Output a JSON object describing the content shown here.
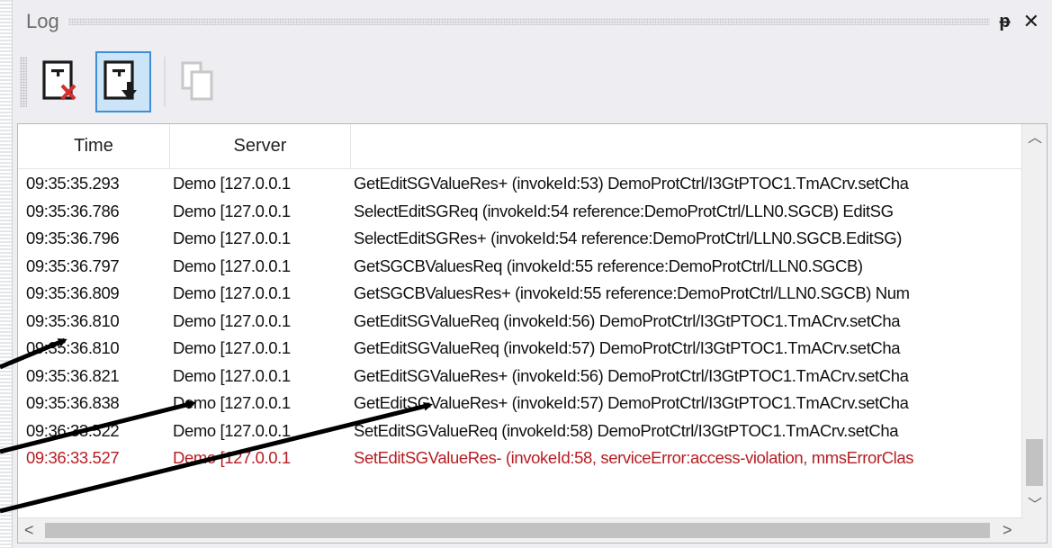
{
  "window": {
    "title": "Log",
    "pin_glyph": "ᵽ",
    "close_glyph": "✕"
  },
  "toolbar": {
    "buttons": [
      {
        "icon": "clear-log-icon",
        "checked": false,
        "enabled": true
      },
      {
        "icon": "autoscroll-log-icon",
        "checked": true,
        "enabled": true
      },
      {
        "icon": "copy-icon",
        "checked": false,
        "enabled": false
      }
    ]
  },
  "table": {
    "columns": [
      "Time",
      "Server",
      ""
    ],
    "rows": [
      {
        "time": "09:35:35.293",
        "server": "Demo [127.0.0.1",
        "message": "GetEditSGValueRes+ (invokeId:53) DemoProtCtrl/I3GtPTOC1.TmACrv.setCha",
        "error": false
      },
      {
        "time": "09:35:36.786",
        "server": "Demo [127.0.0.1",
        "message": "SelectEditSGReq   (invokeId:54 reference:DemoProtCtrl/LLN0.SGCB) EditSG",
        "error": false
      },
      {
        "time": "09:35:36.796",
        "server": "Demo [127.0.0.1",
        "message": "SelectEditSGRes+ (invokeId:54 reference:DemoProtCtrl/LLN0.SGCB.EditSG)",
        "error": false
      },
      {
        "time": "09:35:36.797",
        "server": "Demo [127.0.0.1",
        "message": "GetSGCBValuesReq   (invokeId:55 reference:DemoProtCtrl/LLN0.SGCB)",
        "error": false
      },
      {
        "time": "09:35:36.809",
        "server": "Demo [127.0.0.1",
        "message": "GetSGCBValuesRes+ (invokeId:55 reference:DemoProtCtrl/LLN0.SGCB) Num",
        "error": false
      },
      {
        "time": "09:35:36.810",
        "server": "Demo [127.0.0.1",
        "message": "GetEditSGValueReq   (invokeId:56) DemoProtCtrl/I3GtPTOC1.TmACrv.setCha",
        "error": false
      },
      {
        "time": "09:35:36.810",
        "server": "Demo [127.0.0.1",
        "message": "GetEditSGValueReq   (invokeId:57) DemoProtCtrl/I3GtPTOC1.TmACrv.setCha",
        "error": false
      },
      {
        "time": "09:35:36.821",
        "server": "Demo [127.0.0.1",
        "message": "GetEditSGValueRes+ (invokeId:56) DemoProtCtrl/I3GtPTOC1.TmACrv.setCha",
        "error": false
      },
      {
        "time": "09:35:36.838",
        "server": "Demo [127.0.0.1",
        "message": "GetEditSGValueRes+ (invokeId:57) DemoProtCtrl/I3GtPTOC1.TmACrv.setCha",
        "error": false
      },
      {
        "time": "09:36:33.522",
        "server": "Demo [127.0.0.1",
        "message": "SetEditSGValueReq   (invokeId:58) DemoProtCtrl/I3GtPTOC1.TmACrv.setCha",
        "error": false
      },
      {
        "time": "09:36:33.527",
        "server": "Demo [127.0.0.1",
        "message": "SetEditSGValueRes- (invokeId:58, serviceError:access-violation, mmsErrorClas",
        "error": true
      }
    ]
  },
  "scrollbars": {
    "up": "︿",
    "down": "﹀",
    "left": "<",
    "right": ">"
  },
  "colors": {
    "error_text": "#b61e23",
    "panel_bg": "#eeeef2",
    "checked_bg": "#cce4f7",
    "checked_border": "#3c8fd8",
    "delete_x": "#d0312d"
  }
}
